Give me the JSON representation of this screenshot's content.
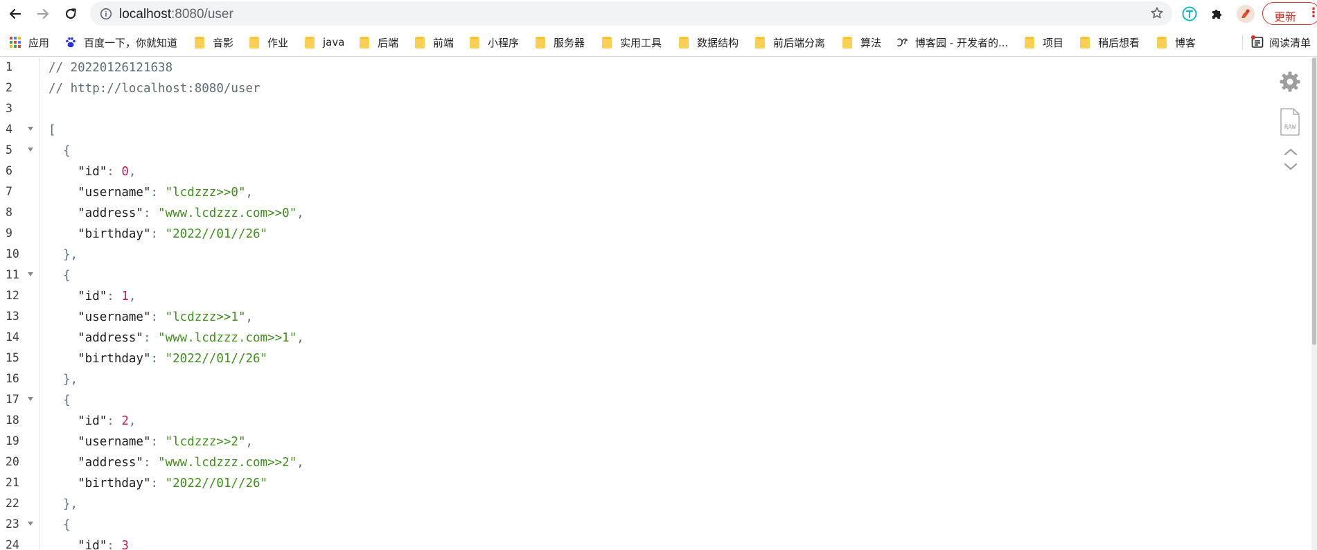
{
  "browser": {
    "url_host": "localhost",
    "url_rest": ":8080/user",
    "update_label": "更新",
    "update_menu_glyph": "⋮",
    "icons": [
      "back-arrow-icon",
      "forward-arrow-icon",
      "reload-icon",
      "info-icon",
      "star-icon",
      "translate-extension-icon",
      "puzzle-extensions-icon",
      "profile-avatar-icon"
    ]
  },
  "bookmarks": [
    {
      "label": "应用",
      "icon": "apps-grid-icon"
    },
    {
      "label": "百度一下，你就知道",
      "icon": "baidu-paw-icon"
    },
    {
      "label": "音影",
      "icon": "folder-icon"
    },
    {
      "label": "作业",
      "icon": "folder-icon"
    },
    {
      "label": "java",
      "icon": "folder-icon"
    },
    {
      "label": "后端",
      "icon": "folder-icon"
    },
    {
      "label": "前端",
      "icon": "folder-icon"
    },
    {
      "label": "小程序",
      "icon": "folder-icon"
    },
    {
      "label": "服务器",
      "icon": "folder-icon"
    },
    {
      "label": "实用工具",
      "icon": "folder-icon"
    },
    {
      "label": "数据结构",
      "icon": "folder-icon"
    },
    {
      "label": "前后端分离",
      "icon": "folder-icon"
    },
    {
      "label": "算法",
      "icon": "folder-icon"
    },
    {
      "label": "博客园 - 开发者的...",
      "icon": "cnblogs-icon"
    },
    {
      "label": "项目",
      "icon": "folder-icon"
    },
    {
      "label": "稍后想看",
      "icon": "folder-icon"
    },
    {
      "label": "博客",
      "icon": "folder-icon"
    }
  ],
  "reading_list": {
    "label": "阅读清单",
    "icon": "reading-list-icon"
  },
  "json_viewer": {
    "tools": [
      "settings-gear-icon",
      "raw-file-icon",
      "chevron-up-icon",
      "chevron-down-icon"
    ],
    "raw_label": "RAW",
    "lines": [
      {
        "n": "1",
        "fold": false,
        "tokens": [
          {
            "t": "comment",
            "v": "// 20220126121638"
          }
        ]
      },
      {
        "n": "2",
        "fold": false,
        "tokens": [
          {
            "t": "comment",
            "v": "// http://localhost:8080/user"
          }
        ]
      },
      {
        "n": "3",
        "fold": false,
        "tokens": []
      },
      {
        "n": "4",
        "fold": true,
        "tokens": [
          {
            "t": "punct",
            "v": "["
          }
        ]
      },
      {
        "n": "5",
        "fold": true,
        "tokens": [
          {
            "t": "punct",
            "v": "  {"
          }
        ]
      },
      {
        "n": "6",
        "fold": false,
        "tokens": [
          {
            "t": "key",
            "v": "    \"id\""
          },
          {
            "t": "punct",
            "v": ": "
          },
          {
            "t": "num",
            "v": "0"
          },
          {
            "t": "punct",
            "v": ","
          }
        ]
      },
      {
        "n": "7",
        "fold": false,
        "tokens": [
          {
            "t": "key",
            "v": "    \"username\""
          },
          {
            "t": "punct",
            "v": ": "
          },
          {
            "t": "str",
            "v": "\"lcdzzz>>0\""
          },
          {
            "t": "punct",
            "v": ","
          }
        ]
      },
      {
        "n": "8",
        "fold": false,
        "tokens": [
          {
            "t": "key",
            "v": "    \"address\""
          },
          {
            "t": "punct",
            "v": ": "
          },
          {
            "t": "str",
            "v": "\"www.lcdzzz.com>>0\""
          },
          {
            "t": "punct",
            "v": ","
          }
        ]
      },
      {
        "n": "9",
        "fold": false,
        "tokens": [
          {
            "t": "key",
            "v": "    \"birthday\""
          },
          {
            "t": "punct",
            "v": ": "
          },
          {
            "t": "str",
            "v": "\"2022//01//26\""
          }
        ]
      },
      {
        "n": "10",
        "fold": false,
        "tokens": [
          {
            "t": "punct",
            "v": "  },"
          }
        ]
      },
      {
        "n": "11",
        "fold": true,
        "tokens": [
          {
            "t": "punct",
            "v": "  {"
          }
        ]
      },
      {
        "n": "12",
        "fold": false,
        "tokens": [
          {
            "t": "key",
            "v": "    \"id\""
          },
          {
            "t": "punct",
            "v": ": "
          },
          {
            "t": "num",
            "v": "1"
          },
          {
            "t": "punct",
            "v": ","
          }
        ]
      },
      {
        "n": "13",
        "fold": false,
        "tokens": [
          {
            "t": "key",
            "v": "    \"username\""
          },
          {
            "t": "punct",
            "v": ": "
          },
          {
            "t": "str",
            "v": "\"lcdzzz>>1\""
          },
          {
            "t": "punct",
            "v": ","
          }
        ]
      },
      {
        "n": "14",
        "fold": false,
        "tokens": [
          {
            "t": "key",
            "v": "    \"address\""
          },
          {
            "t": "punct",
            "v": ": "
          },
          {
            "t": "str",
            "v": "\"www.lcdzzz.com>>1\""
          },
          {
            "t": "punct",
            "v": ","
          }
        ]
      },
      {
        "n": "15",
        "fold": false,
        "tokens": [
          {
            "t": "key",
            "v": "    \"birthday\""
          },
          {
            "t": "punct",
            "v": ": "
          },
          {
            "t": "str",
            "v": "\"2022//01//26\""
          }
        ]
      },
      {
        "n": "16",
        "fold": false,
        "tokens": [
          {
            "t": "punct",
            "v": "  },"
          }
        ]
      },
      {
        "n": "17",
        "fold": true,
        "tokens": [
          {
            "t": "punct",
            "v": "  {"
          }
        ]
      },
      {
        "n": "18",
        "fold": false,
        "tokens": [
          {
            "t": "key",
            "v": "    \"id\""
          },
          {
            "t": "punct",
            "v": ": "
          },
          {
            "t": "num",
            "v": "2"
          },
          {
            "t": "punct",
            "v": ","
          }
        ]
      },
      {
        "n": "19",
        "fold": false,
        "tokens": [
          {
            "t": "key",
            "v": "    \"username\""
          },
          {
            "t": "punct",
            "v": ": "
          },
          {
            "t": "str",
            "v": "\"lcdzzz>>2\""
          },
          {
            "t": "punct",
            "v": ","
          }
        ]
      },
      {
        "n": "20",
        "fold": false,
        "tokens": [
          {
            "t": "key",
            "v": "    \"address\""
          },
          {
            "t": "punct",
            "v": ": "
          },
          {
            "t": "str",
            "v": "\"www.lcdzzz.com>>2\""
          },
          {
            "t": "punct",
            "v": ","
          }
        ]
      },
      {
        "n": "21",
        "fold": false,
        "tokens": [
          {
            "t": "key",
            "v": "    \"birthday\""
          },
          {
            "t": "punct",
            "v": ": "
          },
          {
            "t": "str",
            "v": "\"2022//01//26\""
          }
        ]
      },
      {
        "n": "22",
        "fold": false,
        "tokens": [
          {
            "t": "punct",
            "v": "  },"
          }
        ]
      },
      {
        "n": "23",
        "fold": true,
        "tokens": [
          {
            "t": "punct",
            "v": "  {"
          }
        ]
      },
      {
        "n": "24",
        "fold": false,
        "tokens": [
          {
            "t": "key",
            "v": "    \"id\""
          },
          {
            "t": "punct",
            "v": ": "
          },
          {
            "t": "num",
            "v": "3"
          }
        ]
      }
    ]
  }
}
